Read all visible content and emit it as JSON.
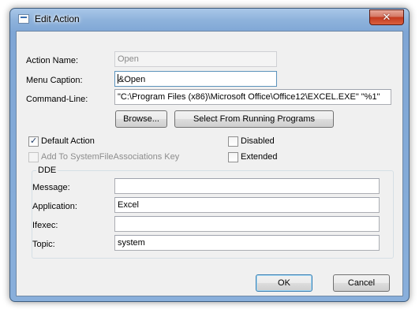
{
  "window": {
    "title": "Edit Action",
    "close_glyph": "✕"
  },
  "fields": {
    "action_name": {
      "label": "Action Name:",
      "value": "Open"
    },
    "menu_caption": {
      "label": "Menu Caption:",
      "value": "&Open"
    },
    "command_line": {
      "label": "Command-Line:",
      "value": "\"C:\\Program Files (x86)\\Microsoft Office\\Office12\\EXCEL.EXE\" \"%1\""
    }
  },
  "buttons": {
    "browse": "Browse...",
    "select_running": "Select From Running Programs",
    "ok": "OK",
    "cancel": "Cancel"
  },
  "options": {
    "default_action": {
      "label": "Default Action",
      "checked": true
    },
    "add_sfa": {
      "label": "Add To SystemFileAssociations Key",
      "checked": false,
      "disabled": true
    },
    "disabled": {
      "label": "Disabled",
      "checked": false
    },
    "extended": {
      "label": "Extended",
      "checked": false
    }
  },
  "dde": {
    "title": "DDE",
    "message": {
      "label": "Message:",
      "value": ""
    },
    "application": {
      "label": "Application:",
      "value": "Excel"
    },
    "ifexec": {
      "label": "Ifexec:",
      "value": ""
    },
    "topic": {
      "label": "Topic:",
      "value": "system"
    }
  }
}
